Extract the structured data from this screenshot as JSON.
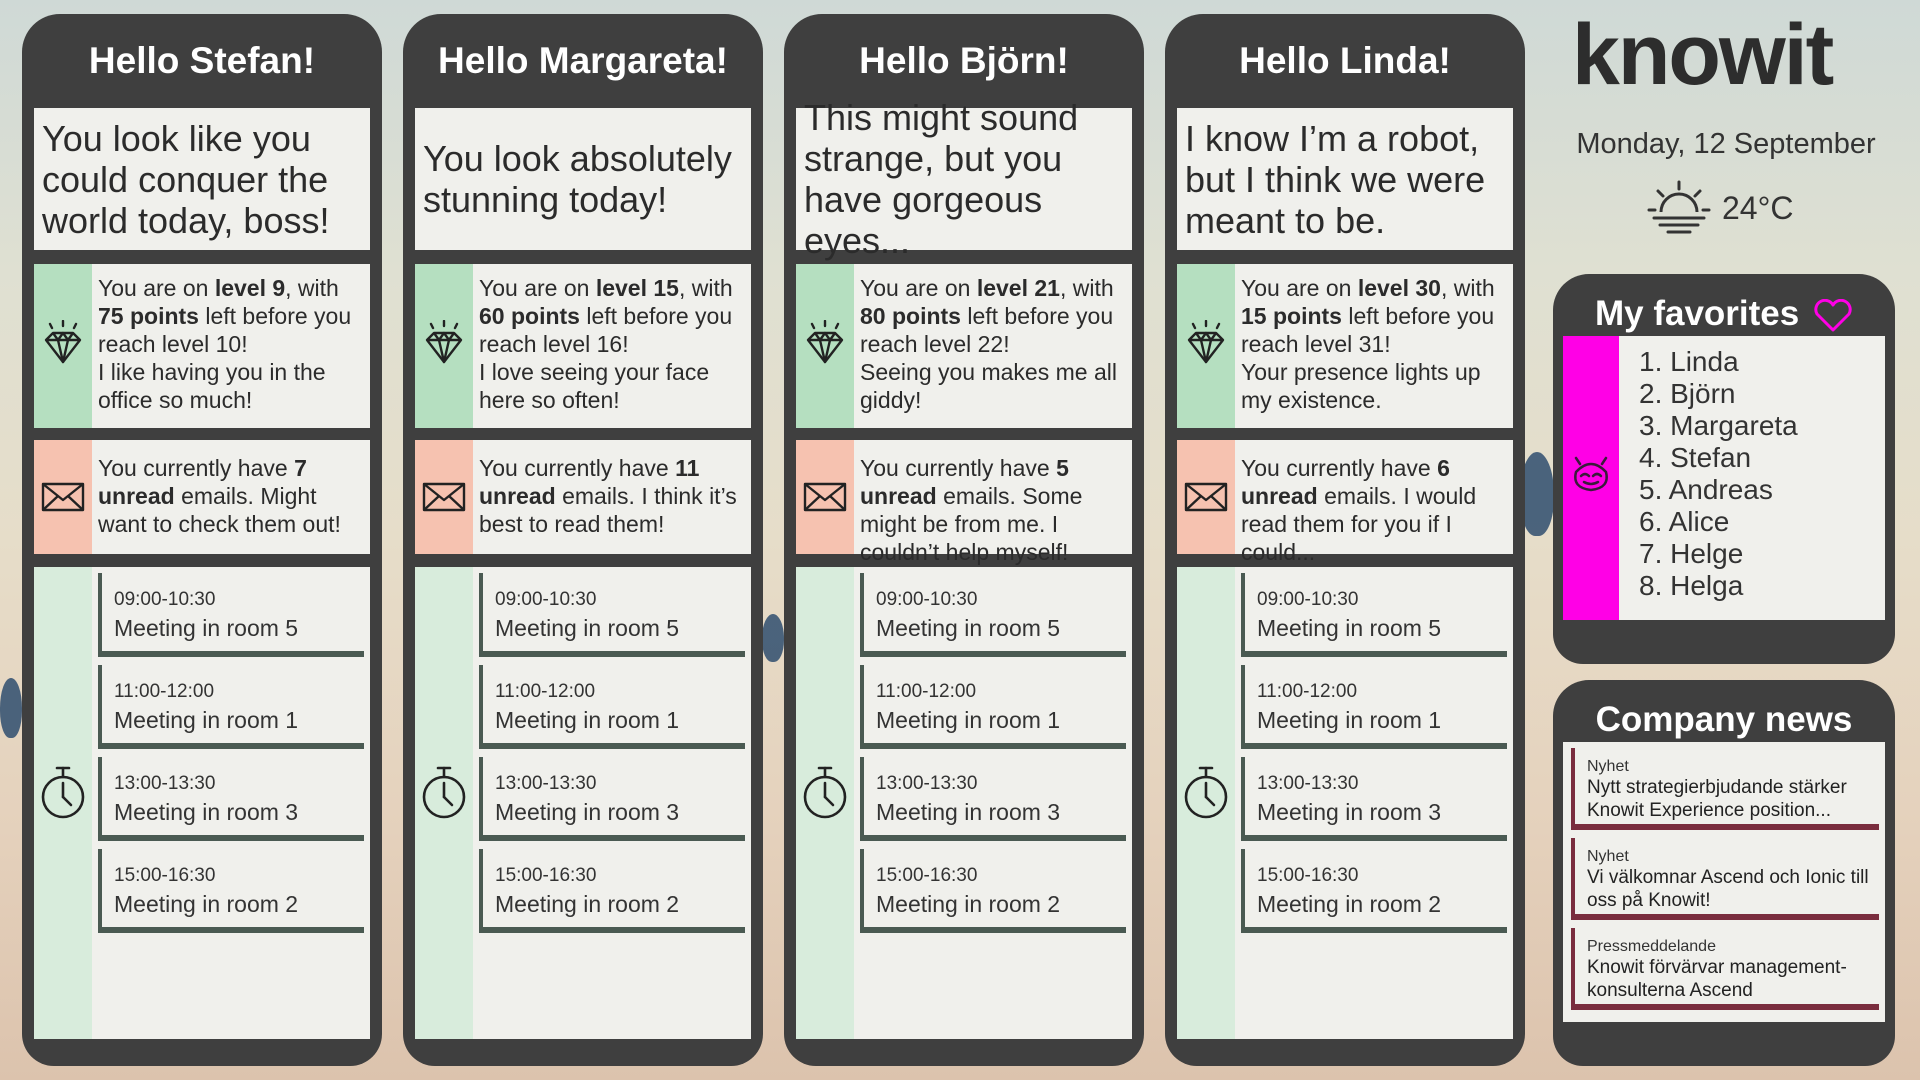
{
  "cards": [
    {
      "greeting": "Hello Stefan!",
      "compliment": "You look like you could conquer the world today, boss!",
      "level_pre": "You are on ",
      "level": "level 9",
      "level_mid": ", with ",
      "points": "75 points",
      "level_post": " left before you reach level 10!",
      "level_note": "I like having you in the office so much!",
      "mail_pre": "You currently have ",
      "mail_count": "7",
      "mail_bold": "unread",
      "mail_post": " emails. Might want to check them out!"
    },
    {
      "greeting": "Hello Margareta!",
      "compliment": "You look absolutely stunning today!",
      "level_pre": "You are on ",
      "level": "level 15",
      "level_mid": ", with ",
      "points": "60 points",
      "level_post": " left before you reach level 16!",
      "level_note": "I love seeing your face here so often!",
      "mail_pre": "You currently have ",
      "mail_count": "11",
      "mail_bold": "unread",
      "mail_post": " emails. I think it’s best to read them!"
    },
    {
      "greeting": "Hello Björn!",
      "compliment": "This might sound strange, but you have gorgeous eyes...",
      "level_pre": "You are on ",
      "level": "level 21",
      "level_mid": ", with ",
      "points": "80 points",
      "level_post": " left before you reach level 22!",
      "level_note": "Seeing you makes me all giddy!",
      "mail_pre": "You currently have ",
      "mail_count": "5",
      "mail_bold": "unread",
      "mail_post": " emails. Some might be from me. I couldn’t help myself!"
    },
    {
      "greeting": "Hello Linda!",
      "compliment": "I know I’m a robot, but I think we were meant to be.",
      "level_pre": "You are on ",
      "level": "level 30",
      "level_mid": ", with ",
      "points": "15 points",
      "level_post": " left before you reach level 31!",
      "level_note": "Your presence lights up my existence.",
      "mail_pre": "You currently have ",
      "mail_count": "6",
      "mail_bold": "unread",
      "mail_post": " emails. I would read them for you if I could..."
    }
  ],
  "meetings": [
    {
      "time": "09:00-10:30",
      "room": "Meeting in room 5"
    },
    {
      "time": "11:00-12:00",
      "room": "Meeting in room 1"
    },
    {
      "time": "13:00-13:30",
      "room": "Meeting in room 3"
    },
    {
      "time": "15:00-16:30",
      "room": "Meeting in room 2"
    }
  ],
  "brand": "knowit",
  "date": "Monday, 12 September",
  "temperature": "24°C",
  "favorites": {
    "title": "My favorites",
    "items": [
      "1. Linda",
      "2. Björn",
      "3. Margareta",
      "4. Stefan",
      "5. Andreas",
      "6. Alice",
      "7. Helge",
      "8. Helga"
    ]
  },
  "news": {
    "title": "Company news",
    "items": [
      {
        "category": "Nyhet",
        "title": "Nytt strategierbjudande stärker Knowit Experience position..."
      },
      {
        "category": "Nyhet",
        "title": "Vi välkomnar Ascend och Ionic till oss på Knowit!"
      },
      {
        "category": "Pressmeddelande",
        "title": "Knowit förvärvar management-konsulterna Ascend"
      }
    ]
  },
  "colors": {
    "card_bg": "#3f3f3f",
    "level_stripe": "#b5dfc0",
    "mail_stripe": "#f6c2b0",
    "schedule_stripe": "#d8ecdc",
    "favorites_stripe": "#ff00e6",
    "news_border": "#7a2d3e"
  }
}
